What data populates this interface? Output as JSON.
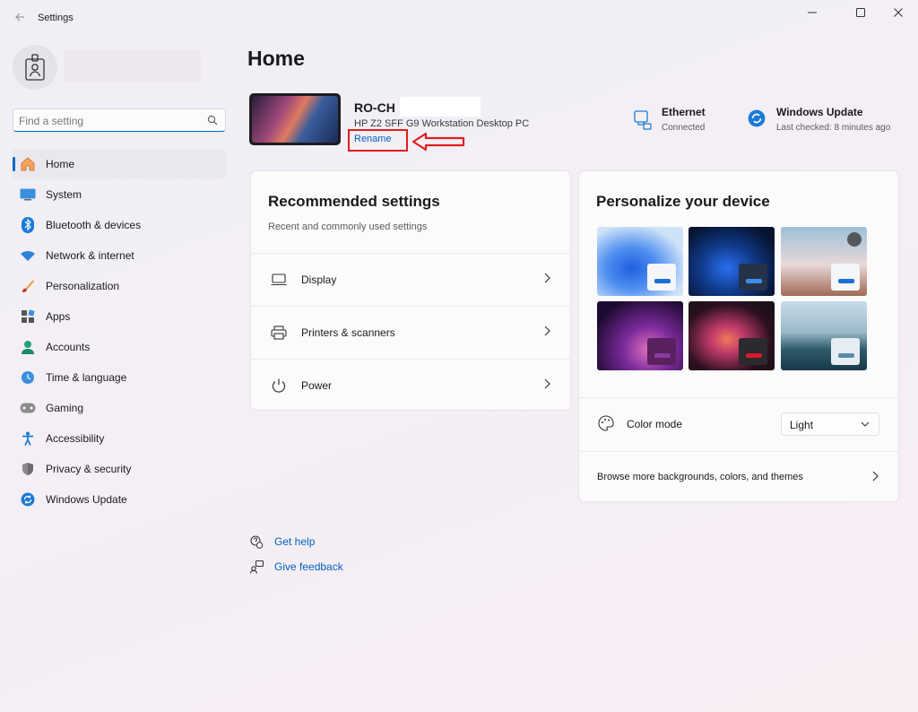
{
  "window": {
    "title": "Settings"
  },
  "search": {
    "placeholder": "Find a setting"
  },
  "sidebar": {
    "items": [
      {
        "label": "Home",
        "icon": "home-icon",
        "active": true
      },
      {
        "label": "System",
        "icon": "system-icon"
      },
      {
        "label": "Bluetooth & devices",
        "icon": "bluetooth-icon"
      },
      {
        "label": "Network & internet",
        "icon": "wifi-icon"
      },
      {
        "label": "Personalization",
        "icon": "brush-icon"
      },
      {
        "label": "Apps",
        "icon": "apps-icon"
      },
      {
        "label": "Accounts",
        "icon": "account-icon"
      },
      {
        "label": "Time & language",
        "icon": "globe-clock-icon"
      },
      {
        "label": "Gaming",
        "icon": "gamepad-icon"
      },
      {
        "label": "Accessibility",
        "icon": "accessibility-icon"
      },
      {
        "label": "Privacy & security",
        "icon": "shield-icon"
      },
      {
        "label": "Windows Update",
        "icon": "update-icon"
      }
    ]
  },
  "main": {
    "title": "Home",
    "device": {
      "name": "RO-CH",
      "model": "HP Z2 SFF G9 Workstation Desktop PC",
      "rename_label": "Rename"
    },
    "status": {
      "ethernet": {
        "title": "Ethernet",
        "subtitle": "Connected"
      },
      "update": {
        "title": "Windows Update",
        "subtitle": "Last checked: 8 minutes ago"
      }
    },
    "recommended": {
      "title": "Recommended settings",
      "subtitle": "Recent and commonly used settings",
      "items": [
        {
          "label": "Display",
          "icon": "monitor-icon"
        },
        {
          "label": "Printers & scanners",
          "icon": "printer-icon"
        },
        {
          "label": "Power",
          "icon": "power-icon"
        }
      ]
    },
    "personalize": {
      "title": "Personalize your device",
      "color_mode_label": "Color mode",
      "color_mode_value": "Light",
      "browse_label": "Browse more backgrounds, colors, and themes"
    },
    "help": {
      "get_help": "Get help",
      "give_feedback": "Give feedback"
    }
  },
  "colors": {
    "accent": "#0067c0",
    "link": "#0061c2",
    "annotation": "#e01e1e"
  }
}
